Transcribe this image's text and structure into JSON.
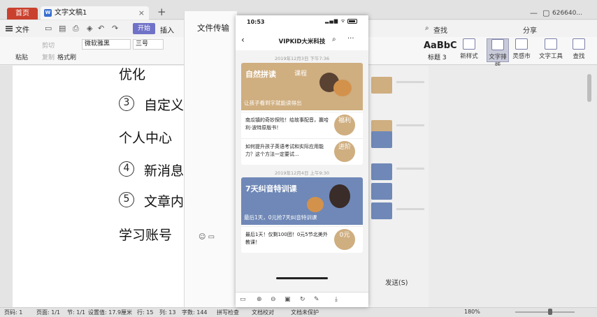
{
  "titlebar": {
    "home_tab": "首页",
    "doc_tab": "文字文稿1",
    "doc_tab_badge": "W",
    "close": "×",
    "add": "+",
    "user_id": "626640...",
    "win_min": "—",
    "win_max": "▢",
    "win_close": "✕"
  },
  "menubar": {
    "file": "文件",
    "start": "开始",
    "insert": "插入",
    "search": "查找",
    "share": "分享"
  },
  "toolbar": {
    "paste": "粘贴",
    "cut": "剪切",
    "copy": "复制",
    "format_painter": "格式刷",
    "font": "微软雅黑",
    "size": "三号",
    "styles_sample": "AaBbC",
    "styles_caption": "标题 3",
    "new_style": "新样式",
    "text_layout": "文字排版",
    "inspiration": "灵感市",
    "text_tools": "文字工具",
    "find": "查找"
  },
  "document": {
    "line1": "优化",
    "n3": "3",
    "line2": "自定义",
    "line3": "个人中心",
    "n4": "4",
    "line4": "新消息",
    "n5": "5",
    "line5": "文章内",
    "line6": "学习账号"
  },
  "upload_panel": {
    "title": "文件传输",
    "send": "发送(S)"
  },
  "phone": {
    "time": "10:53",
    "signal": "▂▄▆ ᯤ",
    "nav_title": "VIPKID大米科技",
    "back": "‹",
    "search": "⌕",
    "more": "···",
    "ts1": "2019年12月3日 下午7:36",
    "banner1_title": "自然拼读",
    "banner1_tag": "课程",
    "banner1_sub": "让孩子看到字就能读得出",
    "row1_text": "南瓜镇的奇妙探险！给故事配音，赢哈利·波特原版书！",
    "row1_badge": "福利",
    "row2_text": "如何提升孩子英语考试和实际应用能力？这个方法一定要试...",
    "row2_badge": "进阶",
    "ts2": "2019年12月4日 上午9:30",
    "banner2_title": "7天纠音特训课",
    "banner2_sub": "最后1天，0元抢7天纠音特训课",
    "row3_text": "最后1天！仅剩100团！0元5节北美外教课！",
    "row3_badge": "0元"
  },
  "statusbar": {
    "page_no": "页码: 1",
    "pages": "页面: 1/1",
    "section": "节: 1/1",
    "setting": "设置值: 17.9厘米",
    "row": "行: 15",
    "col": "列: 13",
    "words": "字数: 144",
    "spell": "拼写检查",
    "proof": "文档校对",
    "unprotected": "文档未保护",
    "zoom": "180%"
  },
  "colors": {
    "wps_red": "#c9402e",
    "ribbon_start": "#6f72c7",
    "banner1": "#cfae80",
    "banner2": "#6f88b7",
    "badge": "#cfae80"
  }
}
